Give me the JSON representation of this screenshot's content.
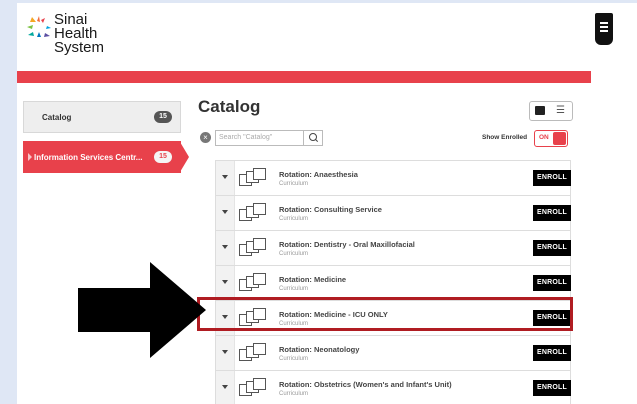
{
  "brand": {
    "logo_lines": [
      "Sinai",
      "Health",
      "System"
    ],
    "accent_color": "#e8414b"
  },
  "sidebar": {
    "items": [
      {
        "label": "Catalog",
        "count": "15"
      },
      {
        "label": "Information Services Centr...",
        "count": "15"
      }
    ]
  },
  "main": {
    "title": "Catalog",
    "search_placeholder": "Search \"Catalog\"",
    "show_enrolled_label": "Show Enrolled",
    "toggle_label": "ON"
  },
  "courses": [
    {
      "title": "Rotation: Anaesthesia",
      "type": "Curriculum",
      "action": "ENROLL"
    },
    {
      "title": "Rotation: Consulting Service",
      "type": "Curriculum",
      "action": "ENROLL"
    },
    {
      "title": "Rotation: Dentistry - Oral Maxillofacial",
      "type": "Curriculum",
      "action": "ENROLL"
    },
    {
      "title": "Rotation: Medicine",
      "type": "Curriculum",
      "action": "ENROLL"
    },
    {
      "title": "Rotation: Medicine - ICU ONLY",
      "type": "Curriculum",
      "action": "ENROLL"
    },
    {
      "title": "Rotation: Neonatology",
      "type": "Curriculum",
      "action": "ENROLL"
    },
    {
      "title": "Rotation: Obstetrics (Women's and Infant's Unit)",
      "type": "Curriculum",
      "action": "ENROLL"
    }
  ]
}
